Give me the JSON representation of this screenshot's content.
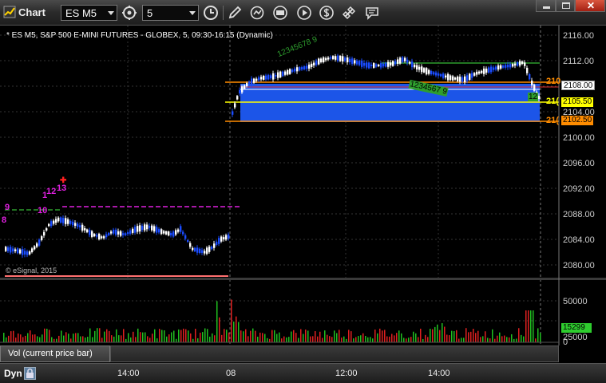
{
  "window": {
    "title": "Chart",
    "symbol": "ES M5",
    "interval": "5"
  },
  "chart": {
    "info": "* ES M5, S&P 500 E-MINI FUTURES - GLOBEX, 5, 09:30-16:15 (Dynamic)",
    "copyright": "© eSignal, 2015",
    "price_ticks": [
      "2116.00",
      "2112.00",
      "2108.00",
      "2104.00",
      "2100.00",
      "2096.00",
      "2092.00",
      "2088.00",
      "2084.00",
      "2080.00"
    ],
    "price_tags": {
      "last": "2108.00",
      "yellow": "2105.50",
      "orange": "2102.50",
      "cut_a": "210",
      "cut_b": "21(",
      "cut_c": "21("
    },
    "setup_counts": {
      "right_green_up": "12345678 9",
      "right_green_down": "1234567 9",
      "right_green_edge": "12",
      "left_9": "9",
      "left_8": "8",
      "left_10": "10",
      "left_1": "1",
      "left_12": "12",
      "left_13": "13"
    },
    "colors": {
      "up_bar": "#ffffff",
      "down_bar": "#1a4cff",
      "fill_blue": "#1c55e8",
      "orange_line": "#ff8c00",
      "yellow_line": "#ffff00",
      "magenta_line": "#e020e0",
      "green_line": "#2e9e2e"
    }
  },
  "volume": {
    "label": "Vol (current price bar)",
    "ticks": [
      "50000",
      "25000",
      "0"
    ],
    "current": "15299"
  },
  "timeline": {
    "mode": "Dyn",
    "labels": [
      "14:00",
      "08",
      "12:00",
      "14:00"
    ]
  }
}
